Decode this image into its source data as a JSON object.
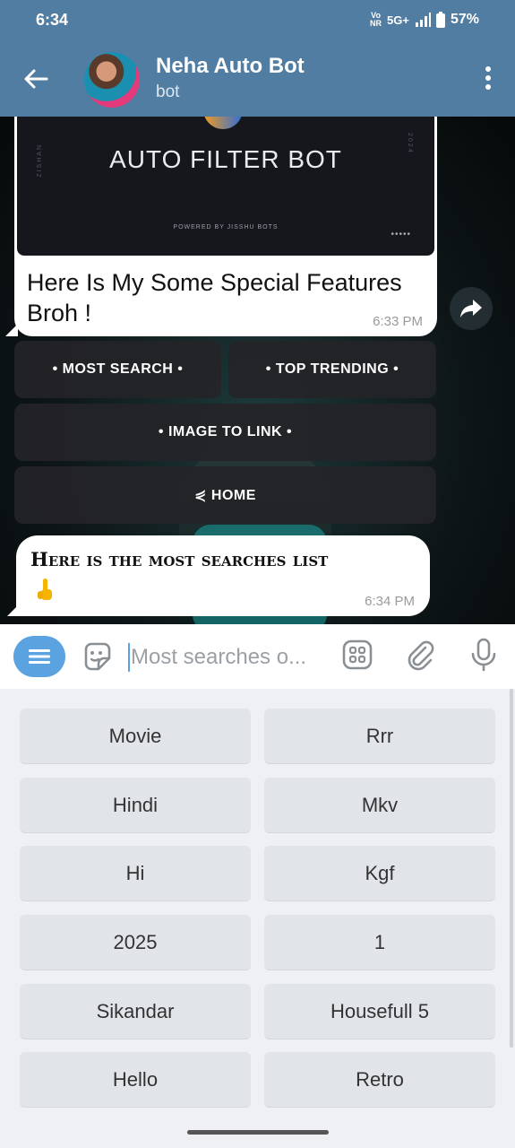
{
  "status": {
    "time": "6:34",
    "net_top": "Vo",
    "net_bottom": "NR",
    "network": "5G+",
    "battery": "57%"
  },
  "header": {
    "title": "Neha Auto Bot",
    "subtitle": "bot"
  },
  "banner": {
    "title": "AUTO FILTER BOT",
    "powered": "POWERED BY JISSHU BOTS",
    "side_left": "ZISHAN",
    "side_right": "2024",
    "dots": "•••••"
  },
  "messages": [
    {
      "text": "Here Is My Some Special Features Broh !",
      "time": "6:33 PM"
    },
    {
      "text": "Here is the most searches list",
      "time": "6:34 PM"
    }
  ],
  "inline_buttons": [
    "• MOST SEARCH •",
    "• TOP TRENDING •",
    "• IMAGE TO LINK •",
    "⋞ HOME"
  ],
  "input": {
    "placeholder": "Most searches o..."
  },
  "keyboard": {
    "rows": [
      [
        "Movie",
        "Rrr"
      ],
      [
        "Hindi",
        "Mkv"
      ],
      [
        "Hi",
        "Kgf"
      ],
      [
        "2025",
        "1"
      ],
      [
        "Sikandar",
        "Housefull 5"
      ],
      [
        "Hello",
        "Retro"
      ]
    ]
  },
  "colors": {
    "header": "#527da3",
    "accent": "#5aa3e0",
    "key_bg": "#e1e4e8"
  },
  "icons": [
    "back-arrow-icon",
    "more-vert-icon",
    "share-icon",
    "menu-icon",
    "sticker-icon",
    "keyboard-grid-icon",
    "attach-icon",
    "mic-icon",
    "point-down-emoji"
  ]
}
